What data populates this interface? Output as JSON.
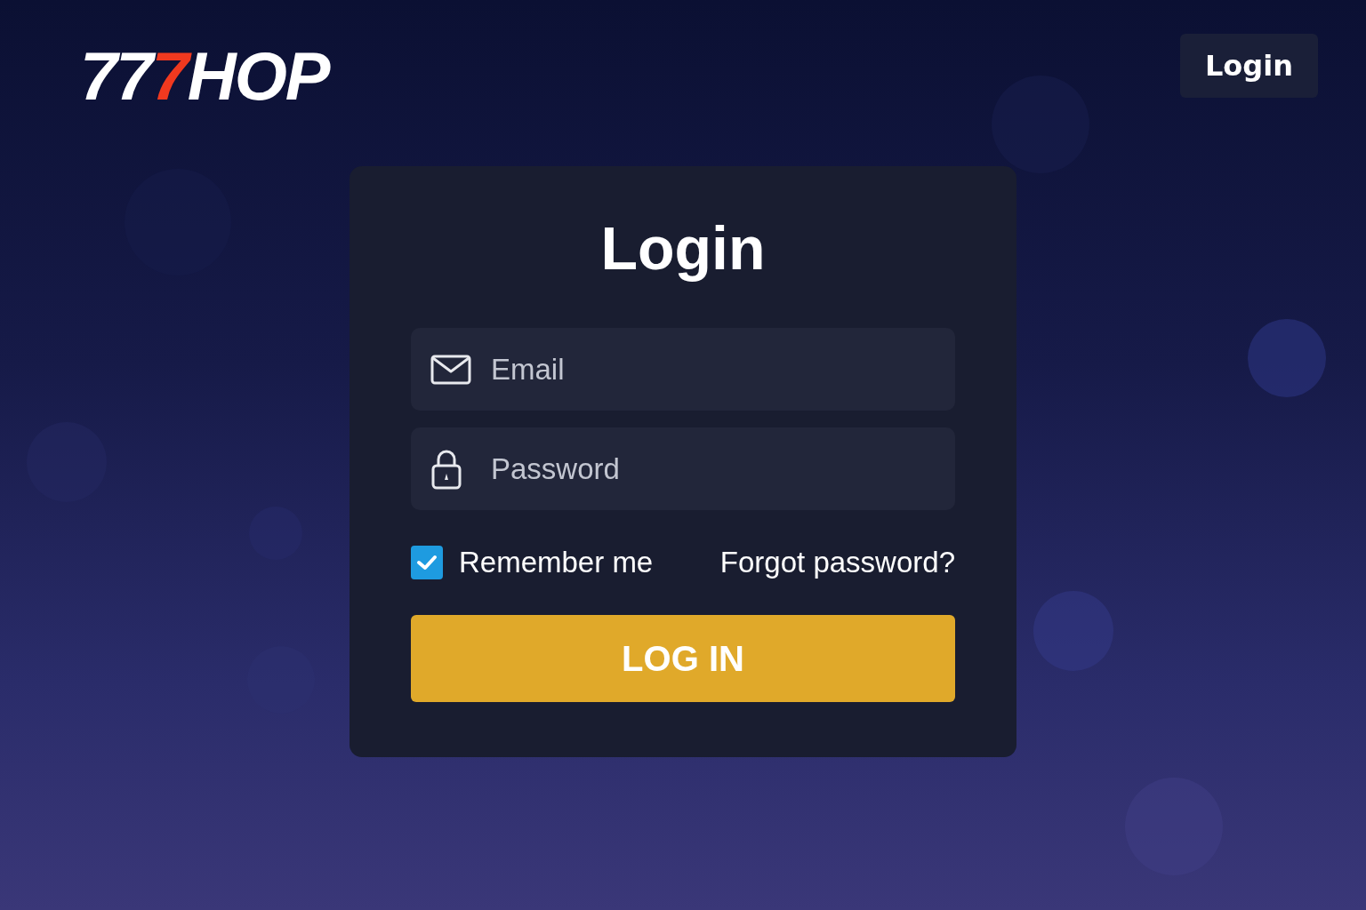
{
  "logo": [
    {
      "text": "77",
      "accent": false
    },
    {
      "text": "7",
      "accent": true
    },
    {
      "text": "HOP",
      "accent": false
    }
  ],
  "header_button": "Login",
  "form": {
    "title": "Login",
    "fields": [
      {
        "kind": "email",
        "placeholder": "Email"
      },
      {
        "kind": "password",
        "placeholder": "Password"
      }
    ],
    "remember": {
      "label": "Remember me",
      "checked": true
    },
    "forgot_link": "Forgot password?",
    "submit": "LOG IN"
  }
}
